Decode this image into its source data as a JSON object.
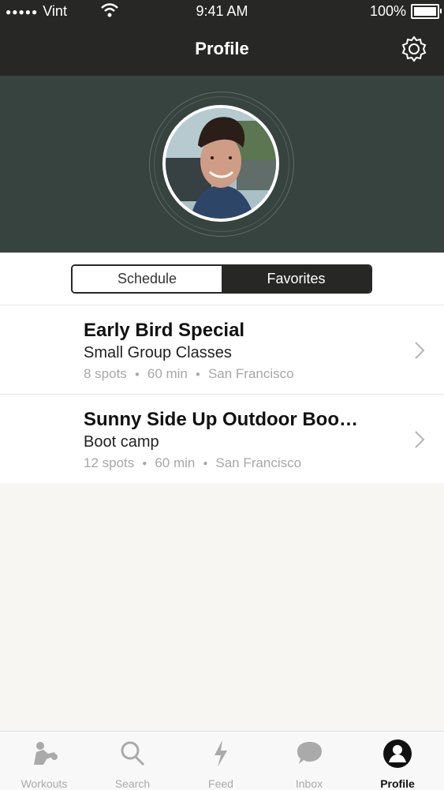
{
  "status": {
    "carrier": "Vint",
    "time": "9:41 AM",
    "battery": "100%"
  },
  "nav": {
    "title": "Profile"
  },
  "segments": [
    {
      "label": "Schedule",
      "active": false
    },
    {
      "label": "Favorites",
      "active": true
    }
  ],
  "classes": [
    {
      "title": "Early Bird Special",
      "subtitle": "Small Group Classes",
      "spots": "8 spots",
      "duration": "60 min",
      "location": "San Francisco"
    },
    {
      "title": "Sunny Side Up Outdoor Boo…",
      "subtitle": "Boot camp",
      "spots": "12 spots",
      "duration": "60 min",
      "location": "San Francisco"
    }
  ],
  "tabs": [
    {
      "label": "Workouts",
      "icon": "workouts-icon"
    },
    {
      "label": "Search",
      "icon": "search-icon"
    },
    {
      "label": "Feed",
      "icon": "lightning-icon"
    },
    {
      "label": "Inbox",
      "icon": "chat-bubble-icon"
    },
    {
      "label": "Profile",
      "icon": "profile-icon",
      "active": true
    }
  ],
  "colors": {
    "dark": "#272726",
    "hero": "#37433f",
    "muted": "#a7a7a7",
    "background": "#f7f6f3"
  }
}
